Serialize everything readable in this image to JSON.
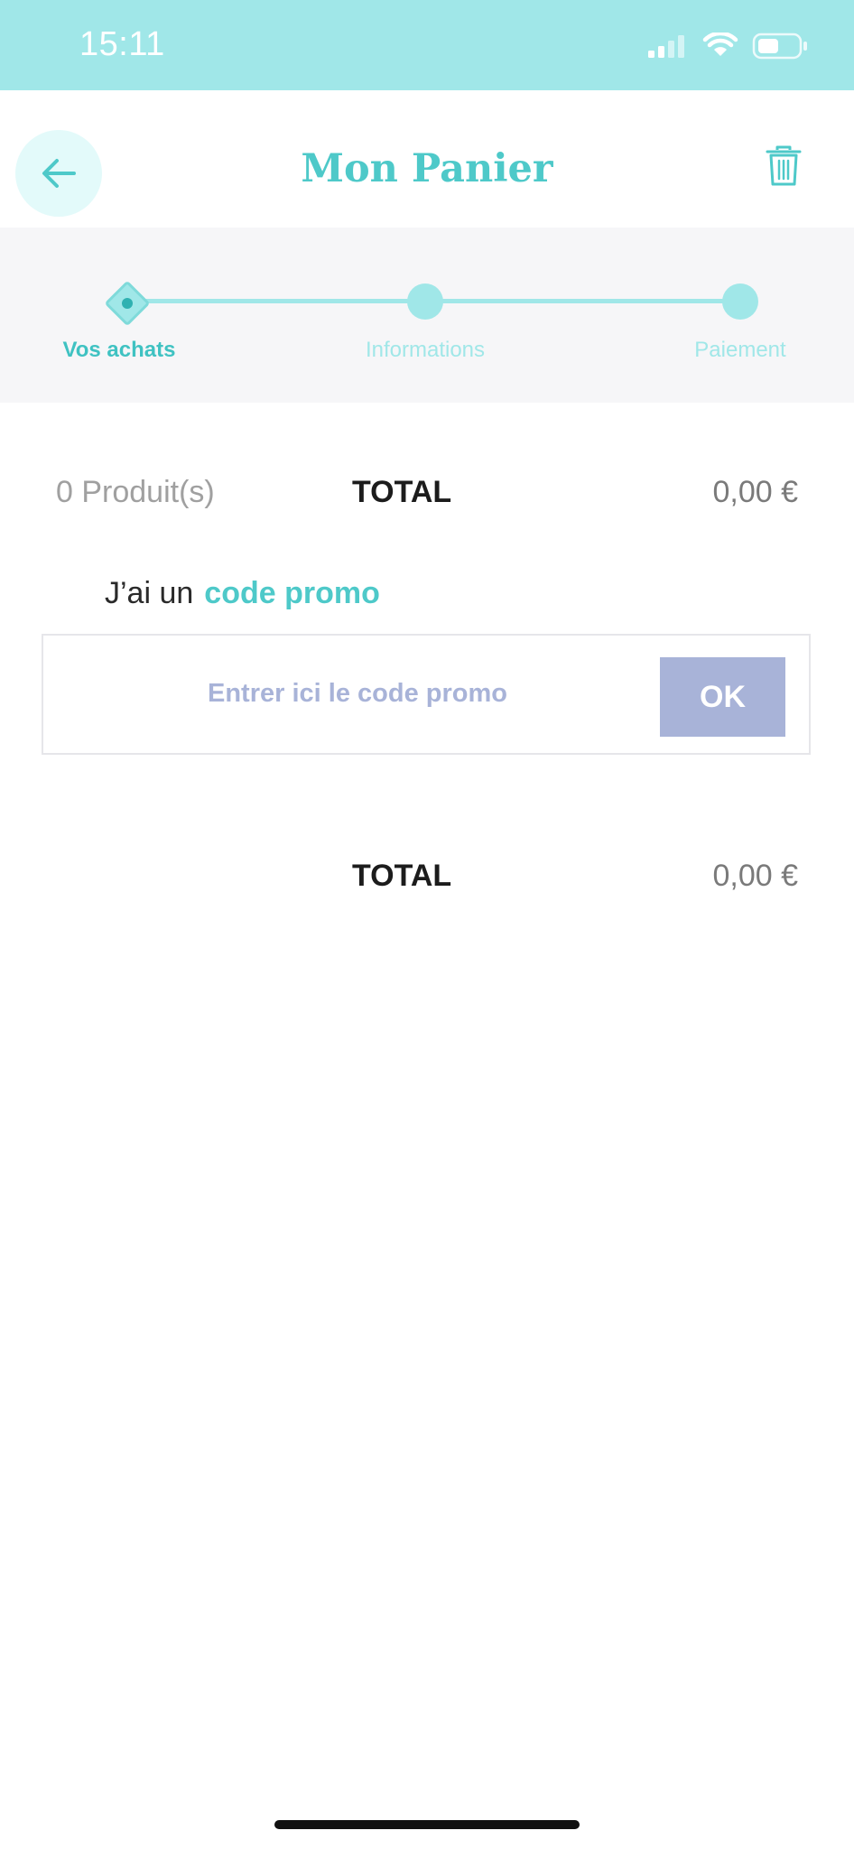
{
  "status_bar": {
    "time": "15:11",
    "icons": [
      "signal-icon",
      "wifi-icon",
      "battery-icon"
    ],
    "color": "#a0e7e8"
  },
  "header": {
    "title": "Mon Panier",
    "back_icon": "arrow-left-icon",
    "trash_icon": "trash-icon",
    "accent": "#4ec9c9"
  },
  "steps": [
    {
      "label": "Vos achats",
      "state": "current"
    },
    {
      "label": "Informations",
      "state": "upcoming"
    },
    {
      "label": "Paiement",
      "state": "upcoming"
    }
  ],
  "summary": {
    "product_count": "0 Produit(s)",
    "total_label": "TOTAL",
    "total_value": "0,00 €"
  },
  "promo": {
    "prefix": "J’ai un",
    "link": "code promo",
    "placeholder": "Entrer ici le code promo",
    "value": "",
    "ok_label": "OK",
    "button_color": "#a8b3d8"
  },
  "grand_total": {
    "label": "TOTAL",
    "value": "0,00 €"
  }
}
